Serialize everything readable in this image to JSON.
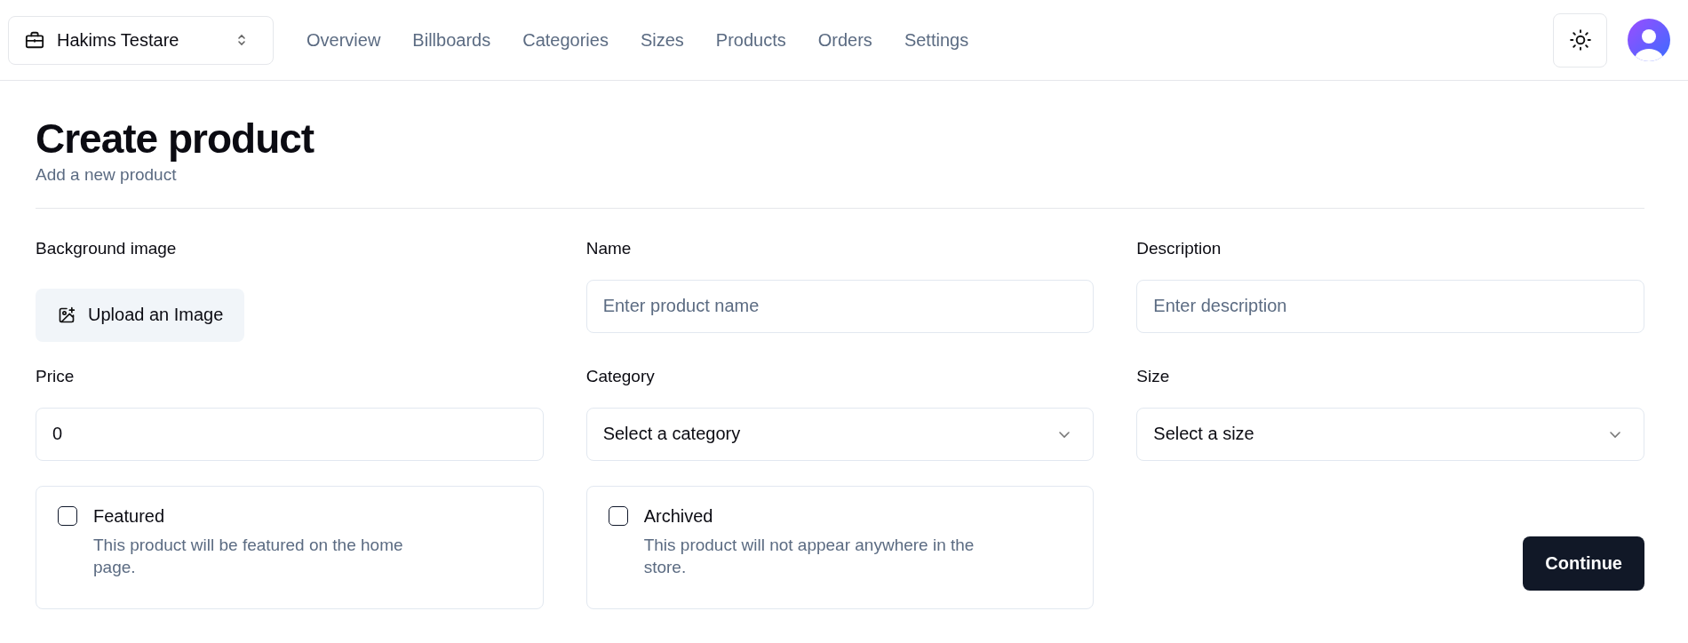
{
  "store_switcher": {
    "label": "Hakims Testare"
  },
  "nav": [
    "Overview",
    "Billboards",
    "Categories",
    "Sizes",
    "Products",
    "Orders",
    "Settings"
  ],
  "heading": {
    "title": "Create product",
    "subtitle": "Add a new product"
  },
  "fields": [
    {
      "kind": "upload",
      "label": "Background image",
      "button": "Upload an Image"
    },
    {
      "kind": "input",
      "label": "Name",
      "placeholder": "Enter product name"
    },
    {
      "kind": "input",
      "label": "Description",
      "placeholder": "Enter description"
    },
    {
      "kind": "input",
      "label": "Price",
      "value": "0"
    },
    {
      "kind": "select",
      "label": "Category",
      "placeholder": "Select a category"
    },
    {
      "kind": "select",
      "label": "Size",
      "placeholder": "Select a size"
    }
  ],
  "checkboxes": [
    {
      "label": "Featured",
      "description": "This product will be featured on the home page.",
      "checked": false
    },
    {
      "label": "Archived",
      "description": "This product will not appear anywhere in the store.",
      "checked": false
    }
  ],
  "submit": "Continue"
}
